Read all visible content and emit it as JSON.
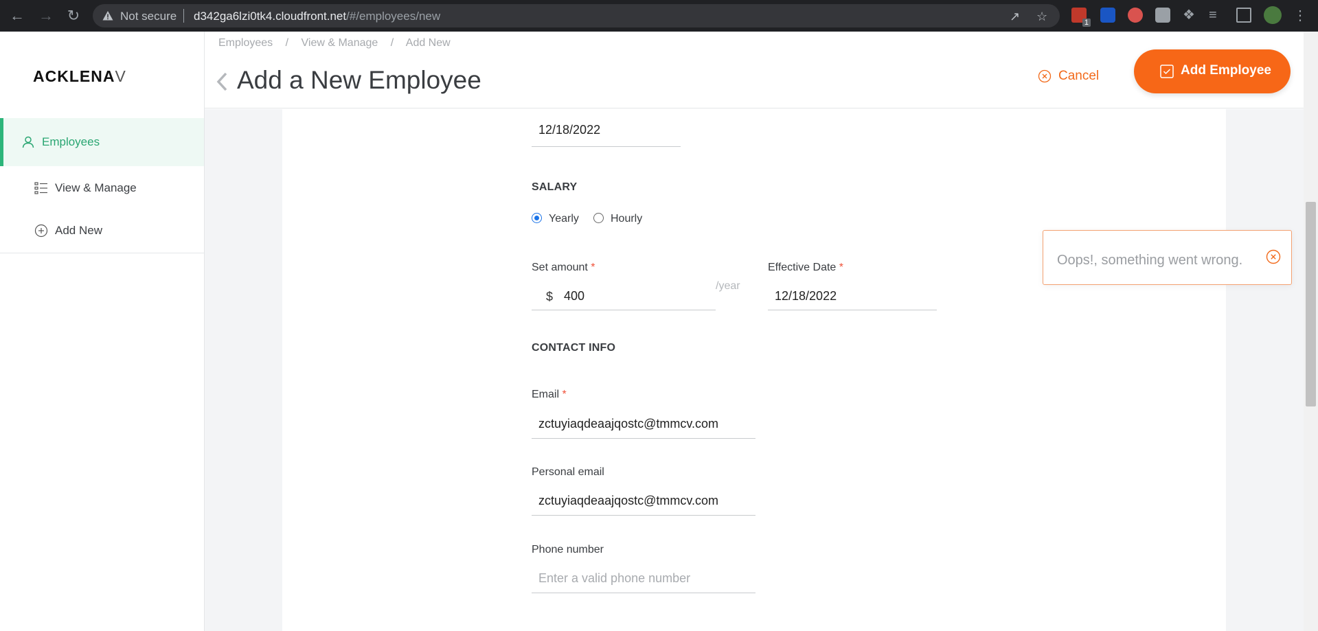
{
  "browser": {
    "security_label": "Not secure",
    "url_host": "d342ga6lzi0tk4.cloudfront.net",
    "url_path": "/#/employees/new",
    "ublock_badge": "1"
  },
  "sidebar": {
    "logo_main": "ACKLENA",
    "logo_cut": "V",
    "items": [
      {
        "label": "Employees",
        "icon": "user-icon",
        "active": true
      },
      {
        "label": "View & Manage",
        "icon": "list-icon",
        "active": false
      },
      {
        "label": "Add New",
        "icon": "plus-circle-icon",
        "active": false
      }
    ]
  },
  "header": {
    "breadcrumb": [
      "Employees",
      "/",
      "View & Manage",
      "/",
      "Add New"
    ],
    "title": "Add a New Employee",
    "cancel_label": "Cancel",
    "add_label": "Add Employee"
  },
  "form": {
    "start_date_value": "12/18/2022",
    "salary": {
      "heading": "SALARY",
      "options": [
        "Yearly",
        "Hourly"
      ],
      "selected": "Yearly",
      "amount_label": "Set amount",
      "currency": "$",
      "amount_value": "400",
      "unit": "/year",
      "effective_label": "Effective Date",
      "effective_value": "12/18/2022",
      "required_mark": "*"
    },
    "contact": {
      "heading": "CONTACT INFO",
      "email_label": "Email",
      "email_value": "zctuyiaqdeaajqostc@tmmcv.com",
      "personal_email_label": "Personal email",
      "personal_email_value": "zctuyiaqdeaajqostc@tmmcv.com",
      "phone_label": "Phone number",
      "phone_placeholder": "Enter a valid phone number"
    }
  },
  "toast": {
    "message": "Oops!, something went wrong."
  },
  "colors": {
    "accent": "#f76717",
    "active_nav": "#2aa672",
    "required": "#f0523a"
  }
}
